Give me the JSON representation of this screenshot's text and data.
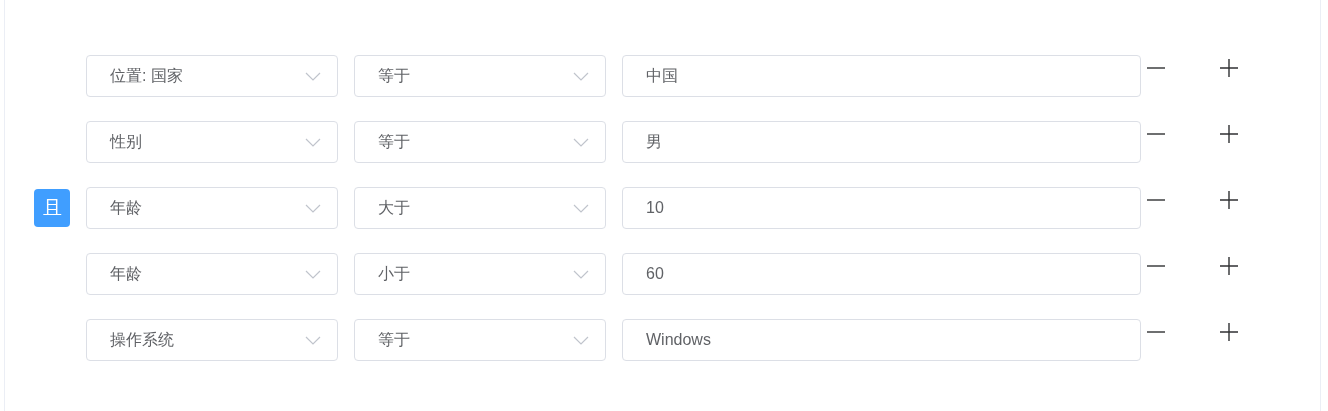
{
  "logic": {
    "label": "且"
  },
  "conditions": [
    {
      "field": "位置: 国家",
      "operator": "等于",
      "value": "中国"
    },
    {
      "field": "性别",
      "operator": "等于",
      "value": "男"
    },
    {
      "field": "年龄",
      "operator": "大于",
      "value": "10"
    },
    {
      "field": "年龄",
      "operator": "小于",
      "value": "60"
    },
    {
      "field": "操作系统",
      "operator": "等于",
      "value": "Windows"
    }
  ]
}
